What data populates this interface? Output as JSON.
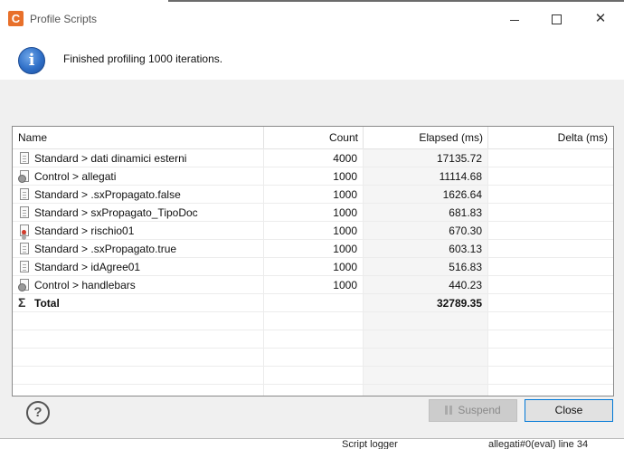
{
  "window": {
    "title": "Profile Scripts",
    "app_icon_letter": "C",
    "controls": [
      "minimize-icon",
      "maximize-icon",
      "close-icon"
    ]
  },
  "message": {
    "icon": "info-icon",
    "text": "Finished profiling 1000 iterations."
  },
  "table": {
    "columns": {
      "name": "Name",
      "count": "Count",
      "elapsed": "Elapsed (ms)",
      "delta": "Delta (ms)"
    },
    "sorted_column": "elapsed",
    "rows": [
      {
        "icon": "document-icon",
        "name": "Standard > dati dinamici esterni",
        "count": "4000",
        "elapsed": "17135.72",
        "delta": ""
      },
      {
        "icon": "control-icon",
        "name": "Control > allegati",
        "count": "1000",
        "elapsed": "11114.68",
        "delta": ""
      },
      {
        "icon": "document-icon",
        "name": "Standard > .sxPropagato.false",
        "count": "1000",
        "elapsed": "1626.64",
        "delta": ""
      },
      {
        "icon": "document-icon",
        "name": "Standard > sxPropagato_TipoDoc",
        "count": "1000",
        "elapsed": "681.83",
        "delta": ""
      },
      {
        "icon": "document-error-icon",
        "name": "Standard > rischio01",
        "count": "1000",
        "elapsed": "670.30",
        "delta": ""
      },
      {
        "icon": "document-icon",
        "name": "Standard > .sxPropagato.true",
        "count": "1000",
        "elapsed": "603.13",
        "delta": ""
      },
      {
        "icon": "document-icon",
        "name": "Standard > idAgree01",
        "count": "1000",
        "elapsed": "516.83",
        "delta": ""
      },
      {
        "icon": "control-icon",
        "name": "Control > handlebars",
        "count": "1000",
        "elapsed": "440.23",
        "delta": ""
      }
    ],
    "total": {
      "icon": "sigma-icon",
      "name": "Total",
      "count": "",
      "elapsed": "32789.35",
      "delta": ""
    }
  },
  "footer": {
    "help_icon": "help-icon",
    "suspend_label": "Suspend",
    "suspend_enabled": false,
    "close_label": "Close"
  },
  "background_text": {
    "left": "Script logger",
    "right": "allegati#0(eval)   line 34"
  }
}
